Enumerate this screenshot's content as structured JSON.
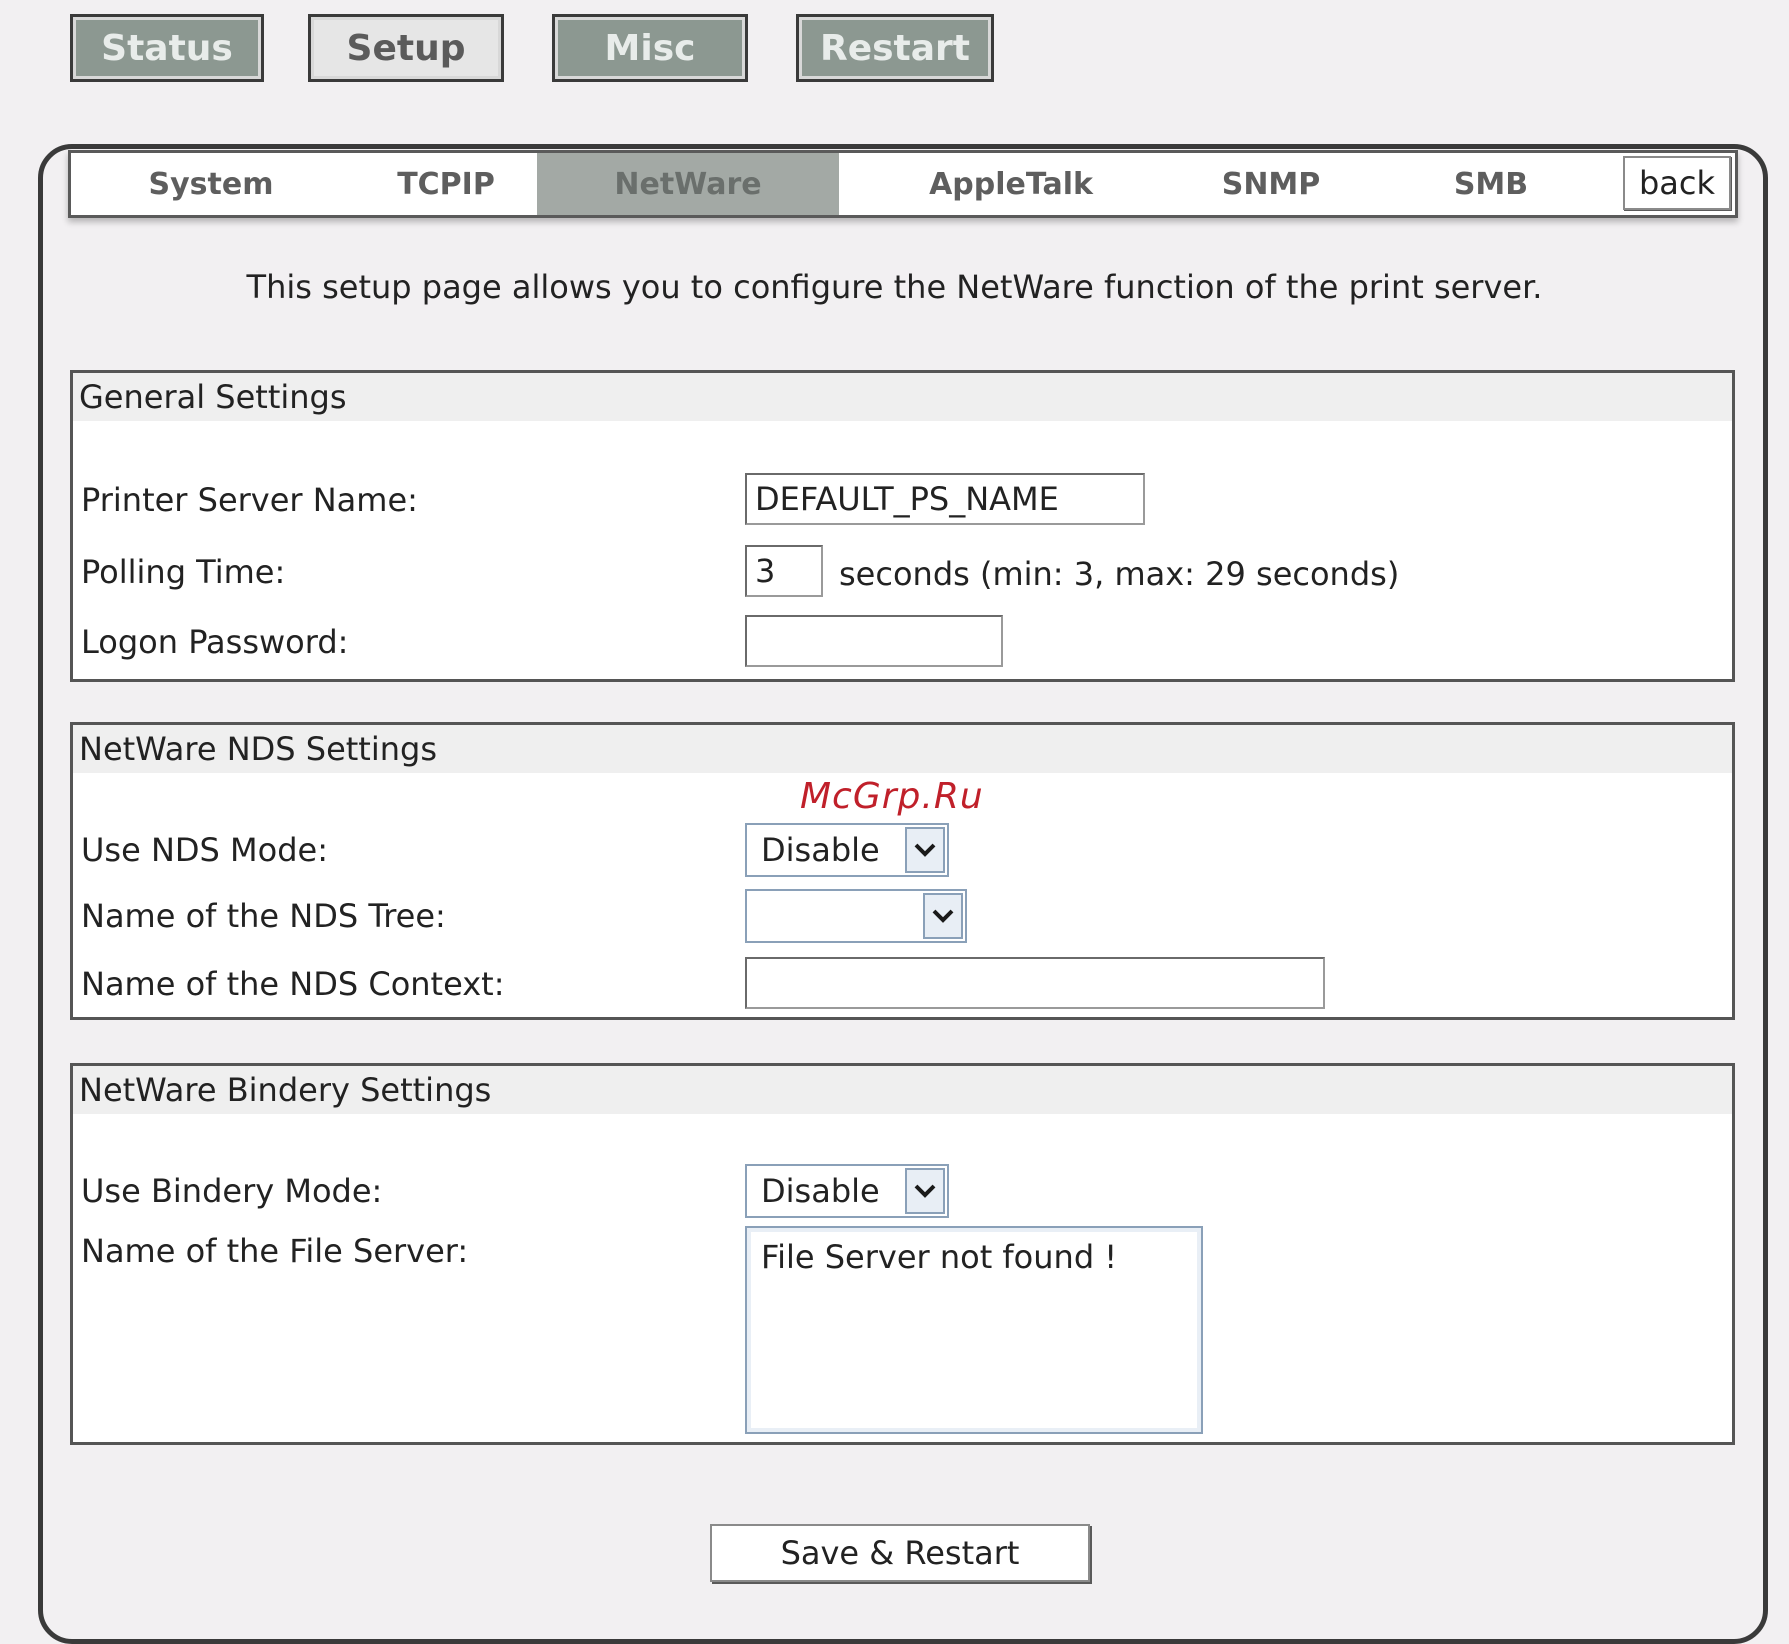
{
  "top_nav": {
    "status": "Status",
    "setup": "Setup",
    "misc": "Misc",
    "restart": "Restart"
  },
  "tabs": {
    "system": "System",
    "tcpip": "TCPIP",
    "netware": "NetWare",
    "appletalk": "AppleTalk",
    "snmp": "SNMP",
    "smb": "SMB",
    "back": "back"
  },
  "intro": "This setup page allows you to configure the NetWare function of the print server.",
  "general": {
    "title": "General Settings",
    "server_name_label": "Printer Server Name:",
    "server_name_value": "DEFAULT_PS_NAME",
    "polling_label": "Polling Time:",
    "polling_value": "3",
    "polling_hint": "seconds (min: 3, max: 29 seconds)",
    "password_label": "Logon Password:",
    "password_value": ""
  },
  "nds": {
    "title": "NetWare NDS Settings",
    "mode_label": "Use NDS Mode:",
    "mode_value": "Disable",
    "tree_label": "Name of the NDS Tree:",
    "tree_value": "",
    "context_label": "Name of the NDS Context:",
    "context_value": ""
  },
  "bindery": {
    "title": "NetWare Bindery Settings",
    "mode_label": "Use Bindery Mode:",
    "mode_value": "Disable",
    "file_server_label": "Name of the File Server:",
    "file_server_item": "File Server not found !"
  },
  "watermark": "McGrp.Ru",
  "save_label": "Save & Restart"
}
